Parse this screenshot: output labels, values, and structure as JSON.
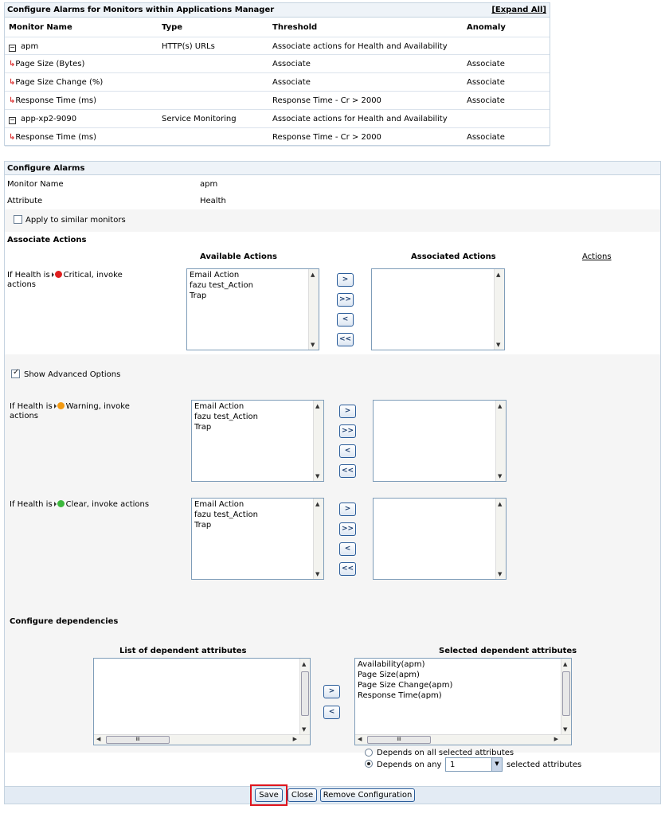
{
  "top_table": {
    "title": "Configure Alarms for Monitors within Applications Manager",
    "expand_all": "[Expand All]",
    "headers": [
      "Monitor Name",
      "Type",
      "Threshold",
      "Anomaly"
    ],
    "rows": [
      {
        "kind": "group",
        "name": "apm",
        "type": "HTTP(s) URLs",
        "threshold": "Associate actions for Health and Availability",
        "anomaly": ""
      },
      {
        "kind": "attr",
        "name": "Page Size (Bytes)",
        "type": "",
        "threshold": "Associate",
        "anomaly": "Associate"
      },
      {
        "kind": "attr",
        "name": "Page Size Change (%)",
        "type": "",
        "threshold": "Associate",
        "anomaly": "Associate"
      },
      {
        "kind": "attr",
        "name": "Response Time (ms)",
        "type": "",
        "threshold": "Response Time - Cr > 2000",
        "anomaly": "Associate"
      },
      {
        "kind": "group",
        "name": "app-xp2-9090",
        "type": "Service Monitoring",
        "threshold": "Associate actions for Health and Availability",
        "anomaly": ""
      },
      {
        "kind": "attr",
        "name": "Response Time (ms)",
        "type": "",
        "threshold": "Response Time - Cr > 2000",
        "anomaly": "Associate"
      }
    ]
  },
  "configure": {
    "title": "Configure Alarms",
    "monitor_name_label": "Monitor Name",
    "monitor_name_value": "apm",
    "attribute_label": "Attribute",
    "attribute_value": "Health",
    "apply_similar": "Apply to similar monitors",
    "associate_actions": "Associate Actions",
    "available_actions": "Available Actions",
    "associated_actions": "Associated Actions",
    "actions_link": "Actions",
    "critical_pre": "If Health is",
    "critical_post": "Critical, invoke actions",
    "warning_pre": "If Health is",
    "warning_post": "Warning, invoke actions",
    "clear_pre": "If Health is",
    "clear_post": "Clear, invoke actions",
    "show_advanced": "Show Advanced Options",
    "action_items": [
      "Email Action",
      "fazu test_Action",
      "Trap"
    ],
    "move_buttons": [
      ">",
      ">>",
      "<",
      "<<"
    ],
    "colors": {
      "critical": "#e02020",
      "warning": "#f39a12",
      "clear": "#3cb83c"
    }
  },
  "dependencies": {
    "title": "Configure dependencies",
    "list_label": "List of dependent attributes",
    "selected_label": "Selected dependent attributes",
    "selected_items": [
      "Availability(apm)",
      "Page Size(apm)",
      "Page Size Change(apm)",
      "Response Time(apm)"
    ],
    "move_right": ">",
    "move_left": "<",
    "depends_all": "Depends on all selected attributes",
    "depends_any": "Depends on any",
    "any_count": "1",
    "selected_suffix": "selected attributes",
    "thumb_glyph": "III"
  },
  "footer": {
    "save": "Save",
    "close": "Close",
    "remove": "Remove Configuration"
  }
}
